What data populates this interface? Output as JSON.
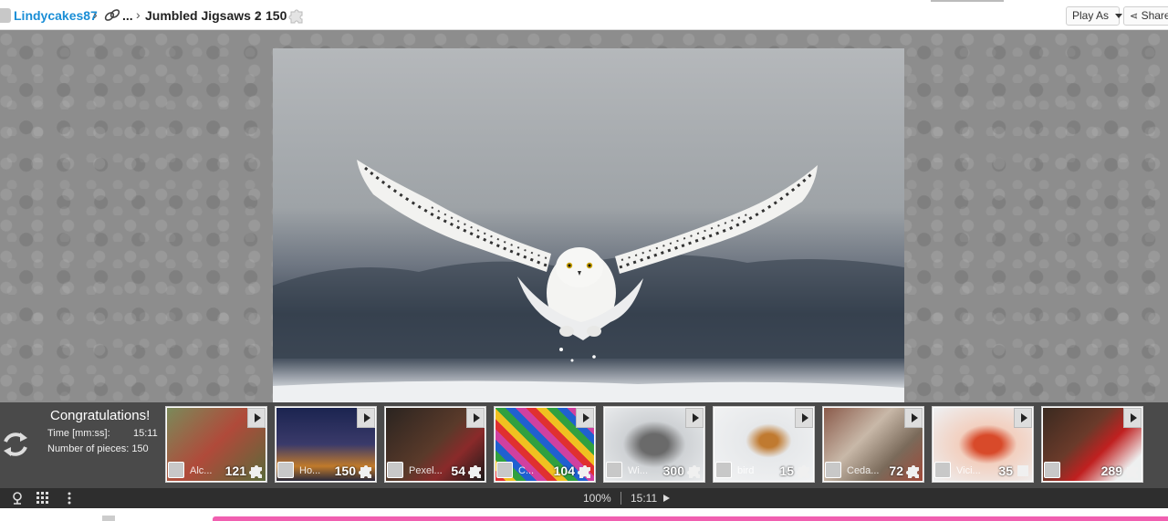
{
  "header": {
    "user": "Lindycakes87",
    "ellipsis": "...",
    "album": "Jumbled Jigsaws 2",
    "piece_count": "150",
    "play_as_label": "Play As",
    "share_label": "Share"
  },
  "result": {
    "title": "Congratulations!",
    "time_label": "Time [mm:ss]:",
    "time_value": "15:11",
    "pieces_label": "Number of pieces: 150"
  },
  "thumbnails": [
    {
      "name": "Alc...",
      "count": "121"
    },
    {
      "name": "Ho...",
      "count": "150"
    },
    {
      "name": "Pexel...",
      "count": "54"
    },
    {
      "name": "C...",
      "count": "104"
    },
    {
      "name": "Wi...",
      "count": "300"
    },
    {
      "name": "bird",
      "count": "15"
    },
    {
      "name": "Ceda...",
      "count": "72"
    },
    {
      "name": "Vici...",
      "count": "35"
    },
    {
      "name": "",
      "count": "289"
    }
  ],
  "status": {
    "zoom": "100%",
    "separator": "|",
    "clock": "15:11"
  },
  "icons": {
    "refresh": "refresh-icon",
    "piece": "puzzle-piece-icon",
    "link": "link-icon",
    "play": "play-icon"
  },
  "colors": {
    "user_link": "#1a8ed6",
    "progress_bar": "#f15fb0"
  }
}
